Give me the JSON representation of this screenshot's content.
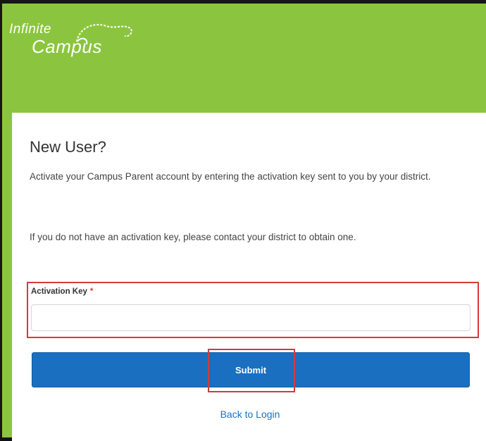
{
  "brand": {
    "line1": "Infinite",
    "line2": "Campus",
    "color": "#8bc53f"
  },
  "form": {
    "title": "New User?",
    "paragraph1": "Activate your Campus Parent account by entering the activation key sent to you by your district.",
    "paragraph2": "If you do not have an activation key, please contact your district to obtain one.",
    "field_label": "Activation Key",
    "required_marker": "*",
    "field_value": "",
    "submit_label": "Submit",
    "back_link_label": "Back to Login"
  },
  "colors": {
    "accent": "#1a6fc0",
    "highlight": "#d43a3a"
  }
}
